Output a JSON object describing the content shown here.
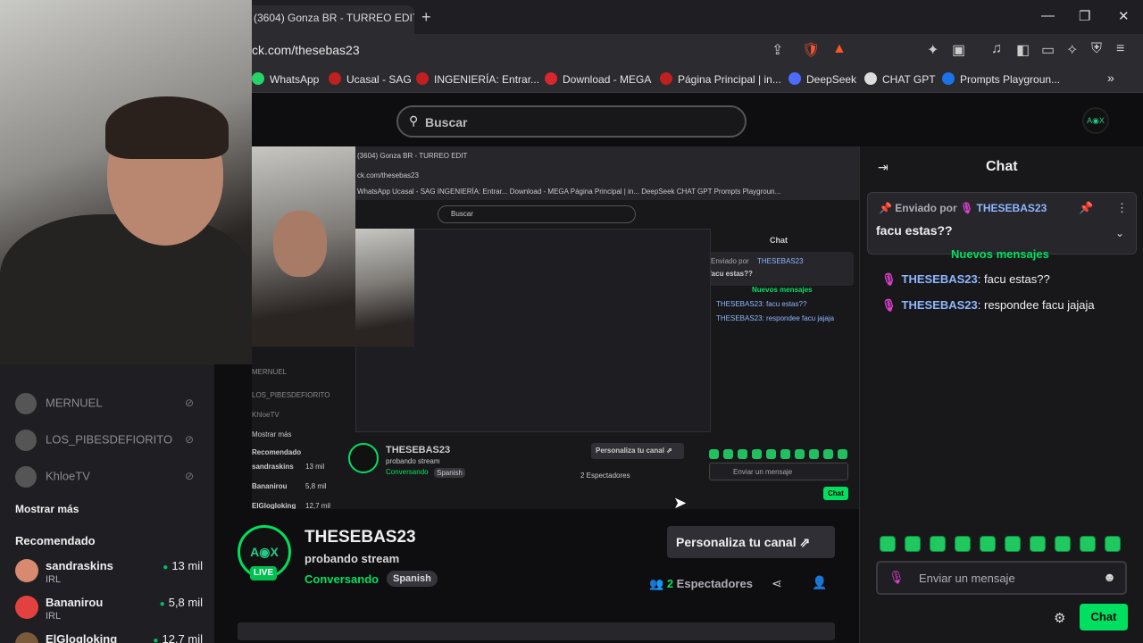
{
  "browser": {
    "tab_title": "(3604) Gonza BR - TURREO EDIT",
    "new_tab": "+",
    "url": "ck.com/thesebas23",
    "window_controls": [
      "—",
      "❐",
      "✕"
    ],
    "bookmarks": [
      {
        "label": "WhatsApp",
        "color": "#25d366"
      },
      {
        "label": "Ucasal - SAG",
        "color": "#c02020"
      },
      {
        "label": "INGENIERÍA: Entrar...",
        "color": "#c02020"
      },
      {
        "label": "Download - MEGA",
        "color": "#d9272e"
      },
      {
        "label": "Página Principal | in...",
        "color": "#c02020"
      },
      {
        "label": "DeepSeek",
        "color": "#4d6bfe"
      },
      {
        "label": "CHAT GPT",
        "color": "#dddddd"
      },
      {
        "label": "Prompts Playgroun...",
        "color": "#1a73e8"
      }
    ],
    "bookmarks_more": "»"
  },
  "header": {
    "search_placeholder": "Buscar",
    "avatar_text": "A◉X"
  },
  "sidebar": {
    "followed": [
      {
        "name": "MERNUEL"
      },
      {
        "name": "LOS_PIBESDEFIORITO"
      },
      {
        "name": "KhloeTV"
      }
    ],
    "show_more": "Mostrar más",
    "recommended_title": "Recomendado",
    "recommended": [
      {
        "name": "sandraskins",
        "category": "IRL",
        "viewers": "13 mil",
        "color": "#d88a70"
      },
      {
        "name": "Bananirou",
        "category": "IRL",
        "viewers": "5,8 mil",
        "color": "#e34040"
      },
      {
        "name": "ElGlogloking",
        "category": "",
        "viewers": "12,7 mil",
        "color": "#7a5a3a"
      }
    ]
  },
  "channel": {
    "name": "THESEBAS23",
    "title": "probando stream",
    "category": "Conversando",
    "tag": "Spanish",
    "live": "LIVE",
    "avatar_text": "A◉X",
    "customize_label": "Personaliza tu canal ⇗",
    "viewers_count": "2",
    "viewers_label": "Espectadores"
  },
  "nested": {
    "tab": "(3604) Gonza BR - TURREO EDIT",
    "url": "ck.com/thesebas23",
    "bookmarks": "WhatsApp   Ucasal - SAG   INGENIERÍA: Entrar...   Download - MEGA   Página Principal | in...   DeepSeek   CHAT GPT   Prompts Playgroun...",
    "search": "Buscar",
    "chat_title": "Chat",
    "pinned_by": "Enviado por",
    "pinned_user": "THESEBAS23",
    "pinned_msg": "facu estas??",
    "new_msgs": "Nuevos mensajes",
    "msg1": "THESEBAS23: facu estas??",
    "msg2": "THESEBAS23: respondee facu jajaja",
    "sidebar_items": [
      "MERNUEL",
      "LOS_PIBESDEFIORITO",
      "KhloeTV",
      "Mostrar más",
      "Recomendado",
      "sandraskins",
      "Bananirou",
      "ElGlogloking"
    ],
    "sidebar_viewers": [
      "13 mil",
      "5,8 mil",
      "12,7 mil"
    ],
    "channel": "THESEBAS23",
    "channel_title": "probando stream",
    "channel_cat": "Conversando",
    "channel_tag": "Spanish",
    "customize": "Personaliza tu canal ⇗",
    "viewers": "2 Espectadores",
    "input": "Enviar un mensaje",
    "chat_btn": "Chat"
  },
  "chat": {
    "title": "Chat",
    "pinned_by_label": "Enviado por",
    "pinned_user": "THESEBAS23",
    "pinned_message": "facu estas??",
    "new_messages": "Nuevos mensajes",
    "messages": [
      {
        "user": "THESEBAS23",
        "text": ": facu estas??"
      },
      {
        "user": "THESEBAS23",
        "text": ": respondee facu jajaja"
      }
    ],
    "input_placeholder": "Enviar un mensaje",
    "send_label": "Chat"
  },
  "colors": {
    "accent": "#00e060",
    "username": "#8fb6ff",
    "mic": "#e040d0"
  }
}
